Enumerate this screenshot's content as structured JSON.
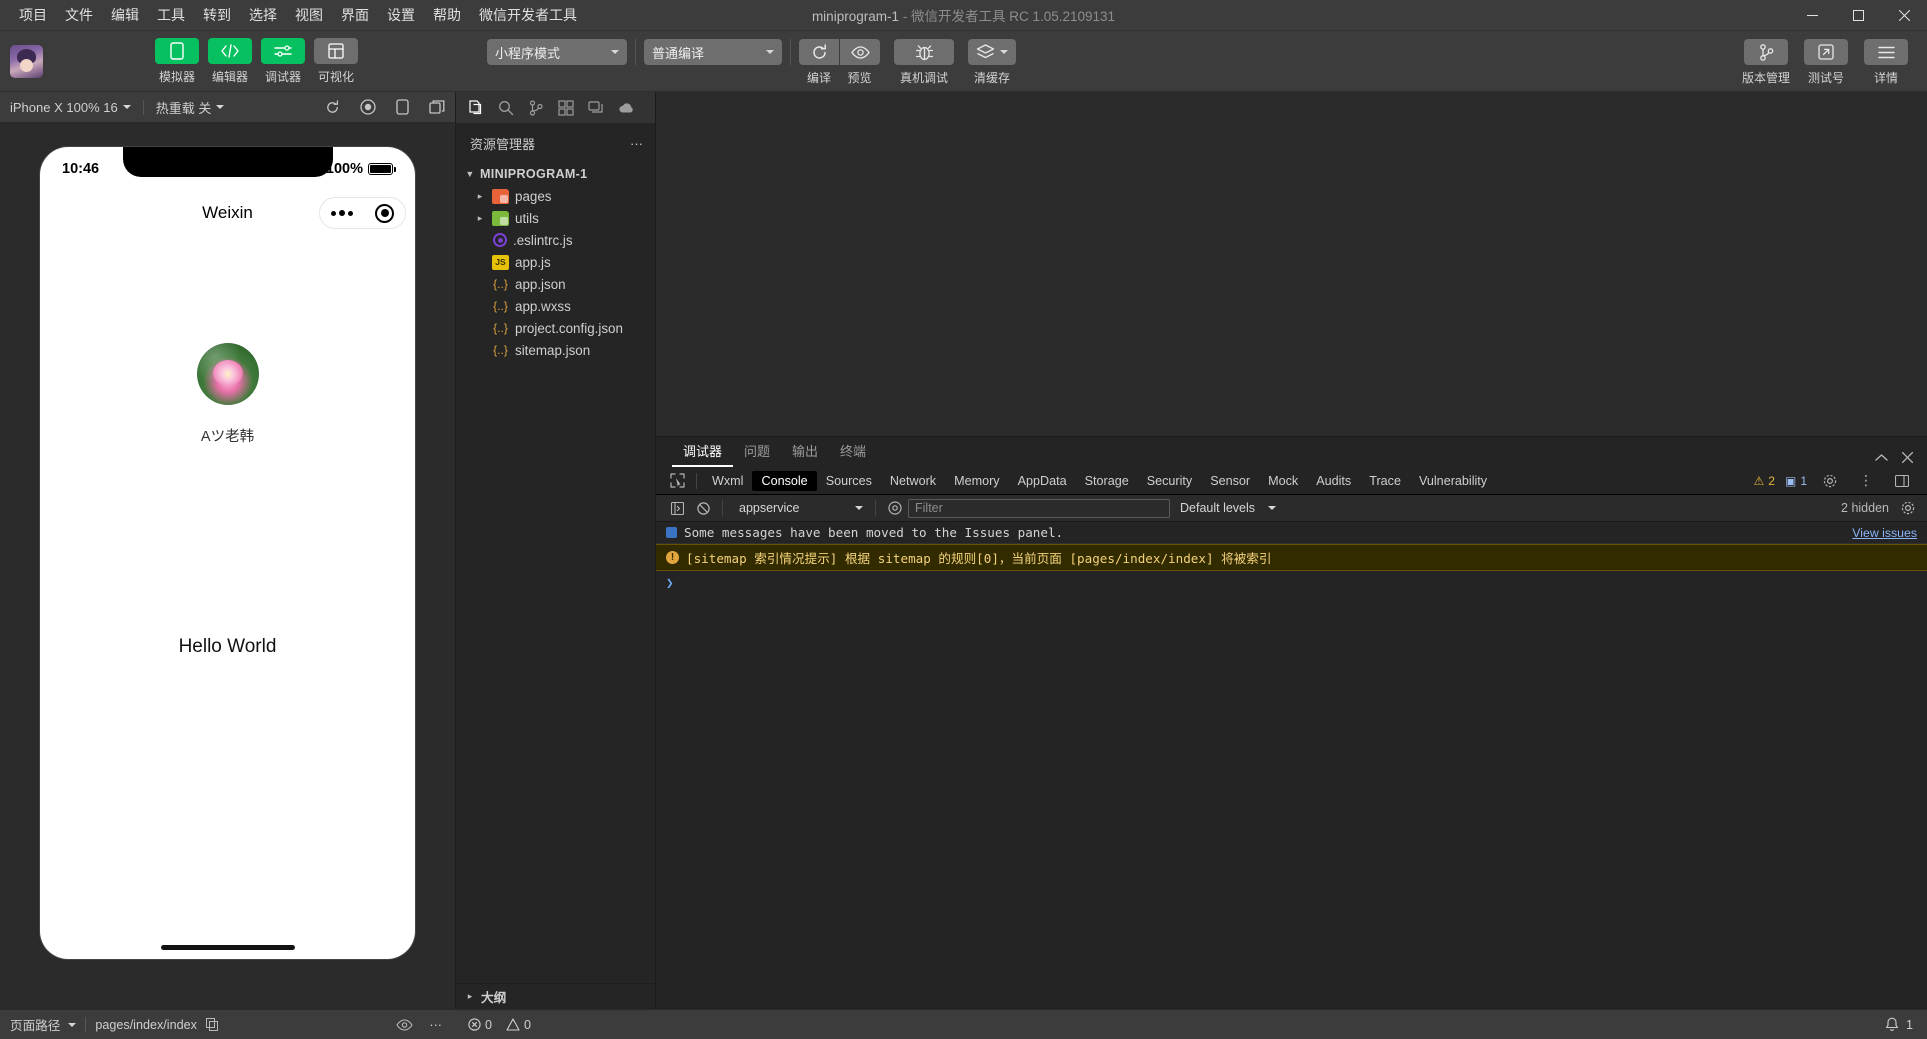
{
  "window": {
    "title_main": "miniprogram-1",
    "title_sep": " - ",
    "title_sub": "微信开发者工具 RC 1.05.2109131",
    "minimize": "−",
    "maximize": "□",
    "close": "✕"
  },
  "menu": {
    "items": [
      {
        "label": "项目"
      },
      {
        "label": "文件"
      },
      {
        "label": "编辑"
      },
      {
        "label": "工具"
      },
      {
        "label": "转到"
      },
      {
        "label": "选择"
      },
      {
        "label": "视图"
      },
      {
        "label": "界面"
      },
      {
        "label": "设置"
      },
      {
        "label": "帮助"
      },
      {
        "label": "微信开发者工具"
      }
    ]
  },
  "toolbar": {
    "left_buttons": [
      {
        "label": "模拟器",
        "icon": "phone-icon",
        "state": "active"
      },
      {
        "label": "编辑器",
        "icon": "code-icon",
        "state": "active"
      },
      {
        "label": "调试器",
        "icon": "sliders-icon",
        "state": "active"
      },
      {
        "label": "可视化",
        "icon": "layout-icon",
        "state": "inactive"
      }
    ],
    "mode_dropdown": {
      "value": "小程序模式"
    },
    "compile_dropdown": {
      "value": "普通编译"
    },
    "center_buttons": [
      {
        "label": "编译",
        "icon": "refresh-icon"
      },
      {
        "label": "预览",
        "icon": "eye-icon"
      },
      {
        "label": "真机调试",
        "icon": "bug-icon"
      },
      {
        "label": "清缓存",
        "icon": "layers-icon"
      }
    ],
    "right_buttons": [
      {
        "label": "版本管理",
        "icon": "git-branch-icon"
      },
      {
        "label": "测试号",
        "icon": "external-link-icon"
      },
      {
        "label": "详情",
        "icon": "menu-icon"
      }
    ]
  },
  "simulator": {
    "device": "iPhone X 100% 16",
    "hot_reload": "热重载 关",
    "icons": [
      "refresh-icon",
      "record-icon",
      "rotate-icon",
      "screenshot-icon"
    ],
    "phone": {
      "time": "10:46",
      "battery_percent": "100%",
      "nav_title": "Weixin",
      "nickname": "Aツ老韩",
      "content": "Hello World"
    }
  },
  "explorer": {
    "activity_icons": [
      "files-icon",
      "search-icon",
      "source-control-icon",
      "extensions-icon",
      "debug-icon",
      "cloud-icon"
    ],
    "header": "资源管理器",
    "more": "···",
    "root": "MINIPROGRAM-1",
    "files": [
      {
        "name": "pages",
        "icon": "folder-orange-icon",
        "arrow": "▸"
      },
      {
        "name": "utils",
        "icon": "folder-green-icon",
        "arrow": "▸"
      },
      {
        "name": ".eslintrc.js",
        "icon": "eslint-icon",
        "arrow": ""
      },
      {
        "name": "app.js",
        "icon": "js-icon",
        "arrow": ""
      },
      {
        "name": "app.json",
        "icon": "json-icon",
        "arrow": ""
      },
      {
        "name": "app.wxss",
        "icon": "json-icon",
        "arrow": ""
      },
      {
        "name": "project.config.json",
        "icon": "json-icon",
        "arrow": ""
      },
      {
        "name": "sitemap.json",
        "icon": "json-icon",
        "arrow": ""
      }
    ],
    "outline": "大纲",
    "outline_arrow": "▸"
  },
  "debugger": {
    "panel_tabs": [
      {
        "label": "调试器",
        "active": true
      },
      {
        "label": "问题",
        "active": false
      },
      {
        "label": "输出",
        "active": false
      },
      {
        "label": "终端",
        "active": false
      }
    ],
    "collapse_icon": "chevron-up-icon",
    "close_icon": "close-icon",
    "devtools_tabs": [
      {
        "label": "Wxml",
        "active": false
      },
      {
        "label": "Console",
        "active": true
      },
      {
        "label": "Sources",
        "active": false
      },
      {
        "label": "Network",
        "active": false
      },
      {
        "label": "Memory",
        "active": false
      },
      {
        "label": "AppData",
        "active": false
      },
      {
        "label": "Storage",
        "active": false
      },
      {
        "label": "Security",
        "active": false
      },
      {
        "label": "Sensor",
        "active": false
      },
      {
        "label": "Mock",
        "active": false
      },
      {
        "label": "Audits",
        "active": false
      },
      {
        "label": "Trace",
        "active": false
      },
      {
        "label": "Vulnerability",
        "active": false
      }
    ],
    "warning_count": "2",
    "info_count": "1",
    "filter_bar": {
      "context": "appservice",
      "filter_placeholder": "Filter",
      "levels": "Default levels",
      "hidden_text": "2 hidden"
    },
    "messages": [
      {
        "type": "info",
        "text": "Some messages have been moved to the Issues panel.",
        "link": "View issues"
      },
      {
        "type": "warn",
        "badge": "!",
        "text": "[sitemap 索引情况提示] 根据 sitemap 的规则[0]，当前页面 [pages/index/index] 将被索引"
      }
    ],
    "prompt": "❯"
  },
  "status_bar": {
    "page_path_label": "页面路径",
    "page_path_value": "pages/index/index",
    "copy_icon": "copy-icon",
    "eye_icon": "eye-icon",
    "more_icon": "···",
    "error_count": "0",
    "warning_count": "0",
    "bell_count": "1"
  },
  "colors": {
    "accent_green": "#07c160",
    "warn_yellow": "#e2a53d",
    "link_blue": "#8ab4f8",
    "titlebar_bg": "#3c3c3c",
    "panel_bg": "#252526",
    "console_bg": "#242424"
  }
}
